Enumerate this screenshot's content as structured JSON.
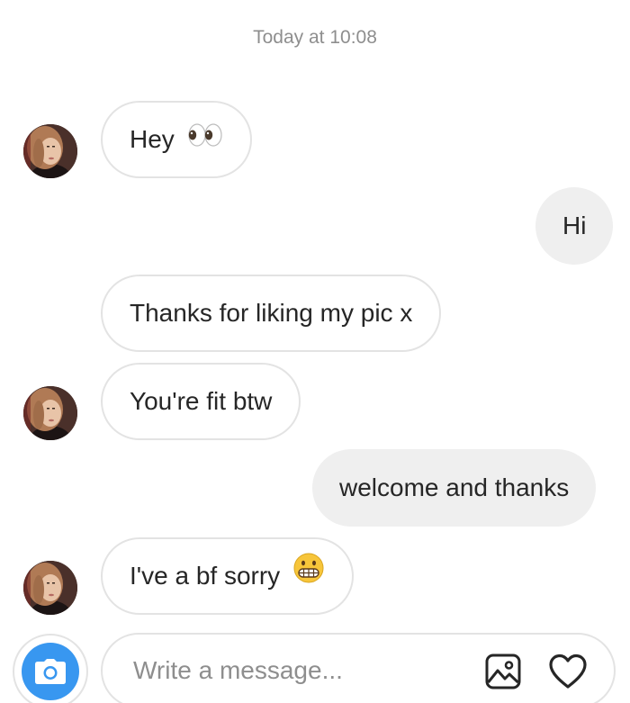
{
  "thread": {
    "timestamp": "Today at 10:08"
  },
  "messages": [
    {
      "direction": "incoming",
      "text": "Hey",
      "emoji": "eyes-emoji",
      "show_avatar": true
    },
    {
      "direction": "outgoing",
      "text": "Hi"
    },
    {
      "direction": "incoming",
      "text": "Thanks for liking my pic x",
      "show_avatar": false
    },
    {
      "direction": "incoming",
      "text": "You're fit btw",
      "show_avatar": true
    },
    {
      "direction": "outgoing",
      "text": "welcome and thanks"
    },
    {
      "direction": "incoming",
      "text": "I've a bf sorry",
      "emoji": "grimacing-face-emoji",
      "show_avatar": true
    }
  ],
  "composer": {
    "placeholder": "Write a message...",
    "left_button_icon": "camera-icon",
    "right_icons": [
      "gallery-icon",
      "heart-icon"
    ]
  },
  "colors": {
    "accent": "#3897f0",
    "outgoing_bubble": "#efefef",
    "incoming_border": "#e3e3e3",
    "muted_text": "#8e8e8e"
  }
}
